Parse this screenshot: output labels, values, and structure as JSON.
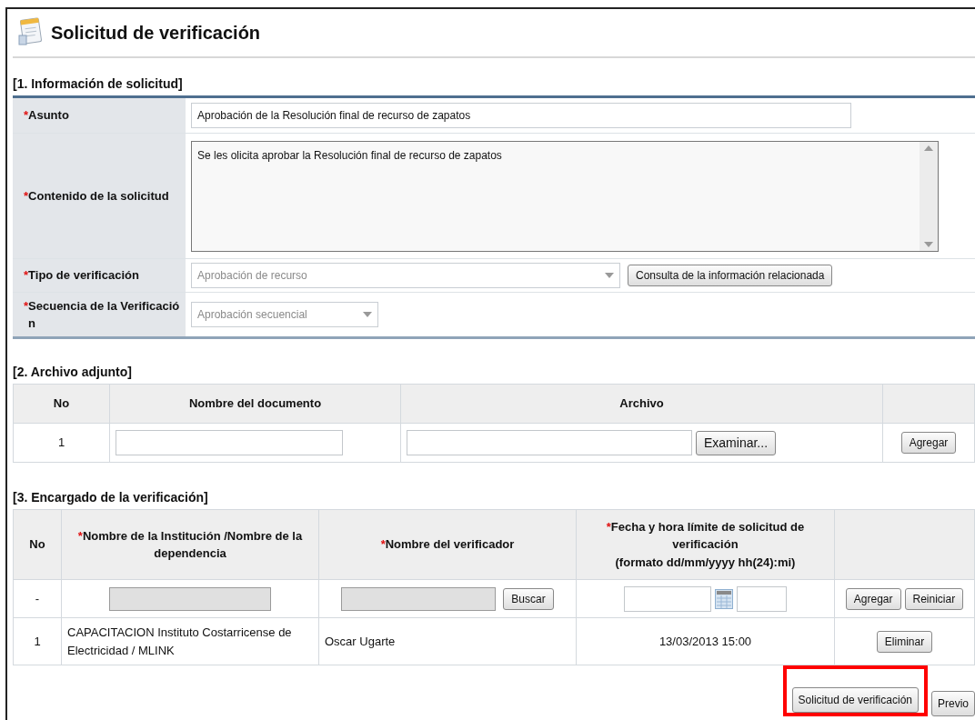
{
  "page": {
    "title": "Solicitud de verificación"
  },
  "section_1": {
    "heading": "[1. Información de solicitud]",
    "fields": [
      {
        "kind": "text",
        "mark": "*",
        "label": "Asunto",
        "value": "Aprobación de la Resolución final de recurso de zapatos"
      },
      {
        "kind": "textarea",
        "mark": "*",
        "label": "Contenido de la solicitud",
        "value": "Se les olicita aprobar la Resolución final de recurso de zapatos"
      },
      {
        "kind": "select",
        "mark": "*",
        "label": "Tipo de verificación",
        "value": "Aprobación de recurso",
        "disabled": true,
        "button": "Consulta de la información relacionada"
      },
      {
        "kind": "select_small",
        "mark": "*",
        "label": "Secuencia de la Verificación",
        "value": "Aprobación secuencial",
        "disabled": true
      }
    ]
  },
  "section_2": {
    "heading": "[2. Archivo adjunto]",
    "columns": [
      "No",
      "Nombre del documento",
      "Archivo"
    ],
    "rows": [
      {
        "no": "1",
        "browse_button": "Examinar...",
        "add_button": "Agregar"
      }
    ]
  },
  "section_3": {
    "heading": "[3. Encargado de la verificación]",
    "columns": [
      {
        "label": "No"
      },
      {
        "mark": "*",
        "label": "Nombre de la Institución /Nombre de la dependencia"
      },
      {
        "mark": "*",
        "label": "Nombre del verificador"
      },
      {
        "mark": "*",
        "label": "Fecha y hora límite de solicitud de verificación",
        "note": "(formato dd/mm/yyyy hh(24):mi)"
      }
    ],
    "entry_row": {
      "no": "-",
      "search_button": "Buscar",
      "add_button": "Agregar",
      "reset_button": "Reiniciar"
    },
    "rows": [
      {
        "no": "1",
        "institution": "CAPACITACION Instituto Costarricense de Electricidad / MLINK",
        "verifier": "Oscar Ugarte",
        "deadline": "13/03/2013 15:00",
        "delete_button": "Eliminar"
      }
    ]
  },
  "actions": [
    {
      "label": "Solicitud de verificación",
      "highlighted": true
    },
    {
      "label": "Previo",
      "highlighted": false
    }
  ]
}
